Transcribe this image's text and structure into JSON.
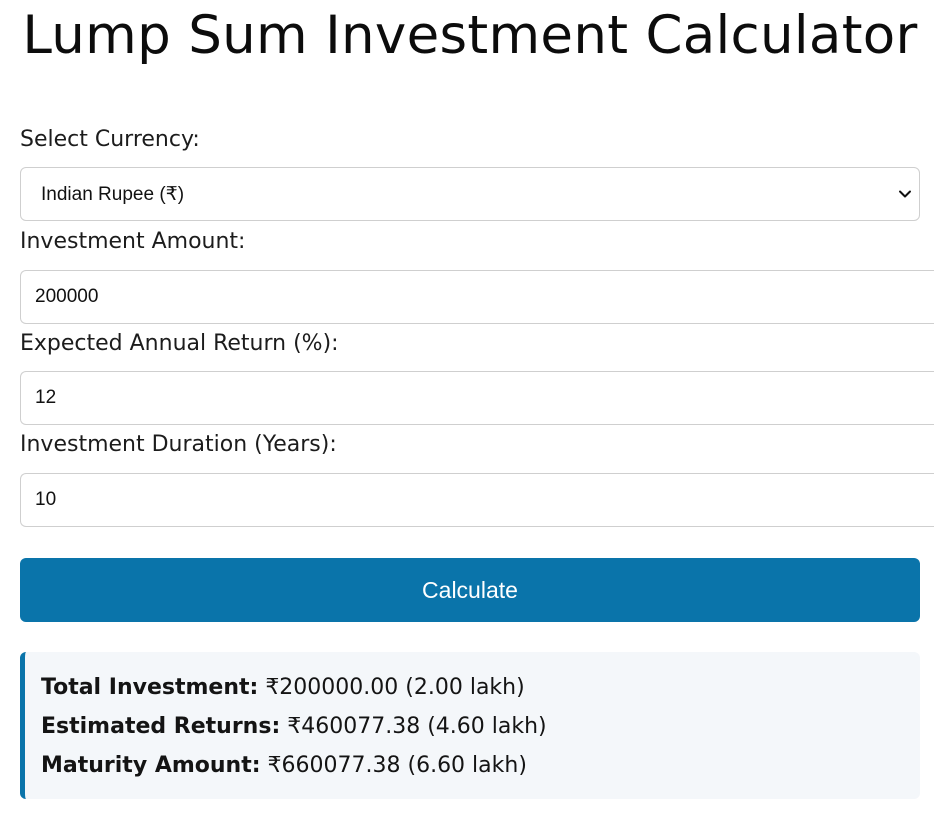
{
  "page": {
    "title": "Lump Sum Investment Calculator"
  },
  "form": {
    "currency_label": "Select Currency:",
    "currency_selected": "Indian Rupee (₹)",
    "amount_label": "Investment Amount:",
    "amount_value": "200000",
    "return_label": "Expected Annual Return (%):",
    "return_value": "12",
    "duration_label": "Investment Duration (Years):",
    "duration_value": "10",
    "calculate_label": "Calculate"
  },
  "results": {
    "total_investment_label": "Total Investment:",
    "total_investment_value": "₹200000.00 (2.00 lakh)",
    "estimated_returns_label": "Estimated Returns:",
    "estimated_returns_value": "₹460077.38 (4.60 lakh)",
    "maturity_amount_label": "Maturity Amount:",
    "maturity_amount_value": "₹660077.38 (6.60 lakh)"
  },
  "colors": {
    "accent": "#0a74aa",
    "results_background": "#f4f7fa"
  },
  "icons": {
    "select_arrow": "chevron-down-icon"
  }
}
